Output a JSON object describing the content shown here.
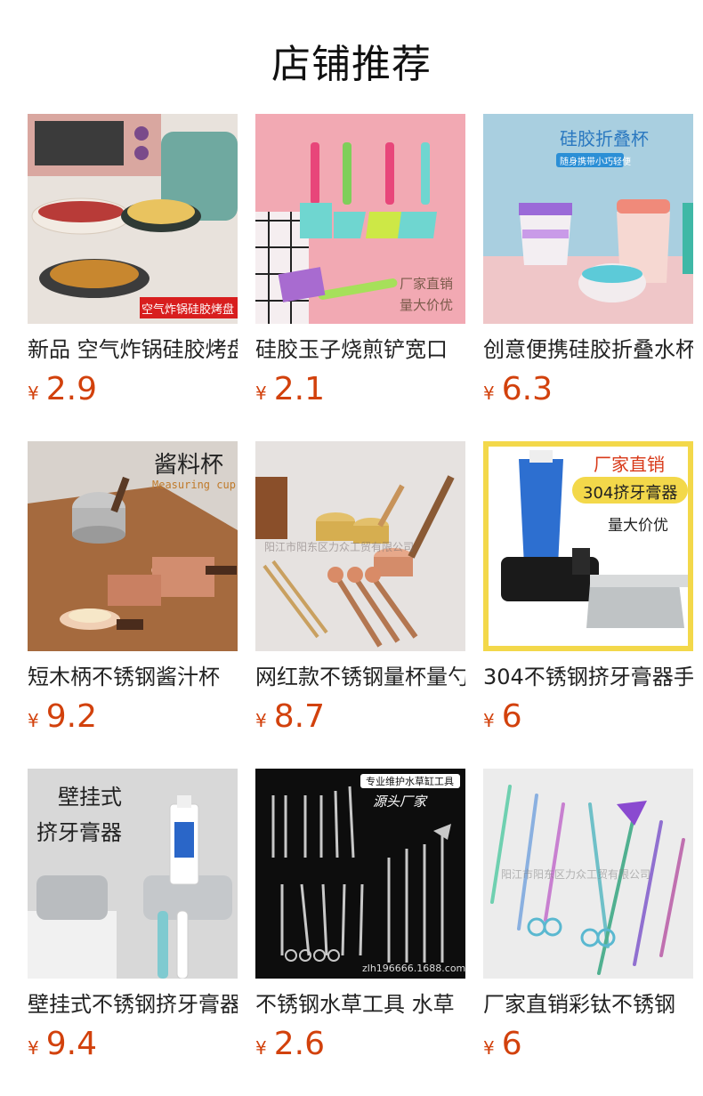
{
  "page_title": "店铺推荐",
  "currency_symbol": "¥",
  "products": [
    {
      "name": "新品 空气炸锅硅胶烤盘",
      "price": "2.9",
      "image_text": [
        "空气炸锅硅胶烤盘"
      ]
    },
    {
      "name": "硅胶玉子烧煎铲宽口",
      "price": "2.1",
      "image_text": [
        "厂家直销",
        "量大价优"
      ]
    },
    {
      "name": "创意便携硅胶折叠水杯",
      "price": "6.3",
      "image_text": [
        "硅胶折叠杯",
        "随身携带",
        "小巧轻便"
      ]
    },
    {
      "name": "短木柄不锈钢酱汁杯",
      "price": "9.2",
      "image_text": [
        "酱料杯",
        "Measuring cup"
      ]
    },
    {
      "name": "网红款不锈钢量杯量勺",
      "price": "8.7",
      "image_text": [
        "阳江市阳东区力众工贸有限公司"
      ]
    },
    {
      "name": "304不锈钢挤牙膏器手",
      "price": "6",
      "image_text": [
        "厂家直销",
        "304挤牙膏器",
        "量大价优"
      ]
    },
    {
      "name": "壁挂式不锈钢挤牙膏器",
      "price": "9.4",
      "image_text": [
        "壁挂式",
        "挤牙膏器"
      ]
    },
    {
      "name": "不锈钢水草工具 水草",
      "price": "2.6",
      "image_text": [
        "专业维护水草缸工具",
        "源头厂家",
        "zlh196666.1688.com"
      ]
    },
    {
      "name": "厂家直销彩钛不锈钢",
      "price": "6",
      "image_text": [
        "阳江市阳东区力众工贸有限公司"
      ]
    }
  ]
}
